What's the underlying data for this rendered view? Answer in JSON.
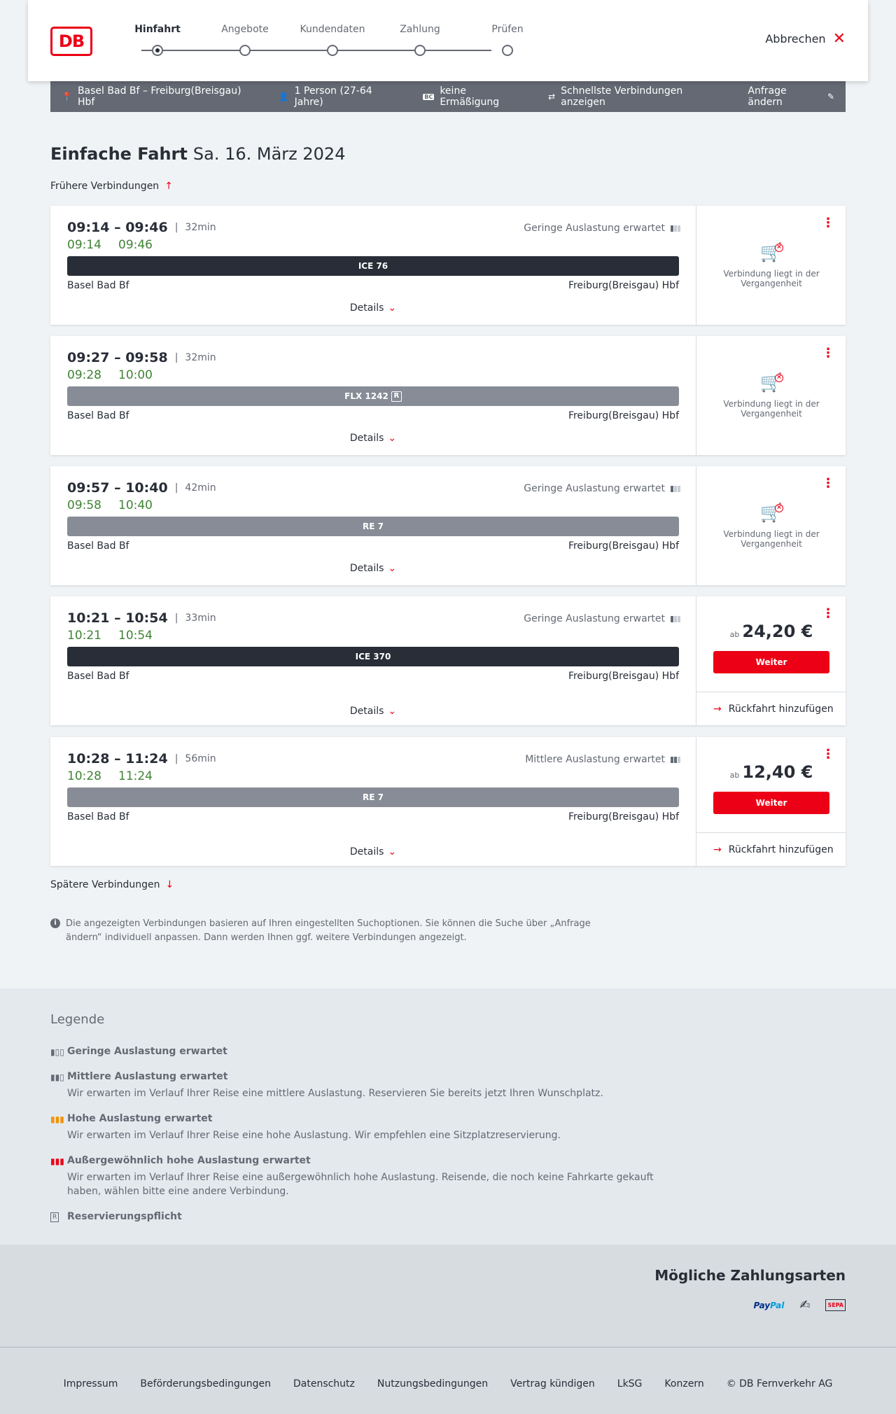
{
  "header": {
    "logo": "DB",
    "steps": [
      "Hinfahrt",
      "Angebote",
      "Kundendaten",
      "Zahlung",
      "Prüfen"
    ],
    "cancel_label": "Abbrechen"
  },
  "infobar": {
    "route": "Basel Bad Bf – Freiburg(Breisgau) Hbf",
    "travelers": "1 Person (27-64 Jahre)",
    "discount": "keine Ermäßigung",
    "fastest": "Schnellste Verbindungen anzeigen",
    "edit": "Anfrage ändern",
    "bc_badge": "BC"
  },
  "page": {
    "title": "Einfache Fahrt",
    "date": "Sa. 16. März 2024",
    "earlier": "Frühere Verbindungen",
    "later": "Spätere Verbindungen",
    "hint": "Die angezeigten Verbindungen basieren auf Ihren eingestellten Suchoptionen. Sie können die Suche über „Anfrage ändern“ individuell anpassen. Dann werden Ihnen ggf. weitere Verbindungen angezeigt."
  },
  "connections": [
    {
      "times": "09:14 – 09:46",
      "duration": "32min",
      "live_dep": "09:14",
      "live_arr": "09:46",
      "occupancy": "Geringe Auslastung erwartet",
      "train": "ICE 76",
      "from": "Basel Bad Bf",
      "to": "Freiburg(Breisgau) Hbf",
      "details": "Details",
      "past": "Verbindung liegt in der Vergangenheit"
    },
    {
      "times": "09:27 – 09:58",
      "duration": "32min",
      "live_dep": "09:28",
      "live_arr": "10:00",
      "occupancy": "",
      "train": "FLX 1242",
      "train_badge": "R",
      "from": "Basel Bad Bf",
      "to": "Freiburg(Breisgau) Hbf",
      "details": "Details",
      "past": "Verbindung liegt in der Vergangenheit"
    },
    {
      "times": "09:57 – 10:40",
      "duration": "42min",
      "live_dep": "09:58",
      "live_arr": "10:40",
      "occupancy": "Geringe Auslastung erwartet",
      "train": "RE 7",
      "from": "Basel Bad Bf",
      "to": "Freiburg(Breisgau) Hbf",
      "details": "Details",
      "past": "Verbindung liegt in der Vergangenheit"
    },
    {
      "times": "10:21 – 10:54",
      "duration": "33min",
      "live_dep": "10:21",
      "live_arr": "10:54",
      "occupancy": "Geringe Auslastung erwartet",
      "train": "ICE 370",
      "from": "Basel Bad Bf",
      "to": "Freiburg(Breisgau) Hbf",
      "details": "Details",
      "price_prefix": "ab",
      "price": "24,20 €",
      "button": "Weiter",
      "return": "Rückfahrt hinzufügen"
    },
    {
      "times": "10:28 – 11:24",
      "duration": "56min",
      "live_dep": "10:28",
      "live_arr": "11:24",
      "occupancy": "Mittlere Auslastung erwartet",
      "train": "RE 7",
      "from": "Basel Bad Bf",
      "to": "Freiburg(Breisgau) Hbf",
      "details": "Details",
      "price_prefix": "ab",
      "price": "12,40 €",
      "button": "Weiter",
      "return": "Rückfahrt hinzufügen"
    }
  ],
  "legend": {
    "title": "Legende",
    "items": [
      {
        "heading": "Geringe Auslastung erwartet",
        "text": ""
      },
      {
        "heading": "Mittlere Auslastung erwartet",
        "text": "Wir erwarten im Verlauf Ihrer Reise eine mittlere Auslastung. Reservieren Sie bereits jetzt Ihren Wunschplatz."
      },
      {
        "heading": "Hohe Auslastung erwartet",
        "text": "Wir erwarten im Verlauf Ihrer Reise eine hohe Auslastung. Wir empfehlen eine Sitzplatzreservierung."
      },
      {
        "heading": "Außergewöhnlich hohe Auslastung erwartet",
        "text": "Wir erwarten im Verlauf Ihrer Reise eine außergewöhnlich hohe Auslastung. Reisende, die noch keine Fahrkarte gekauft haben, wählen bitte eine andere Verbindung."
      },
      {
        "heading": "Reservierungspflicht",
        "text": ""
      }
    ]
  },
  "payment": {
    "title": "Mögliche Zahlungsarten",
    "paypal_a": "Pay",
    "paypal_b": "Pal",
    "sepa": "SEPA"
  },
  "footer": {
    "links": [
      "Impressum",
      "Beförderungsbedingungen",
      "Datenschutz",
      "Nutzungsbedingungen",
      "Vertrag kündigen",
      "LkSG",
      "Konzern",
      "© DB Fernverkehr AG"
    ]
  },
  "colors": {
    "brand_red": "#ec0016",
    "live_green": "#408335",
    "dark": "#282d37",
    "grey": "#646973"
  }
}
